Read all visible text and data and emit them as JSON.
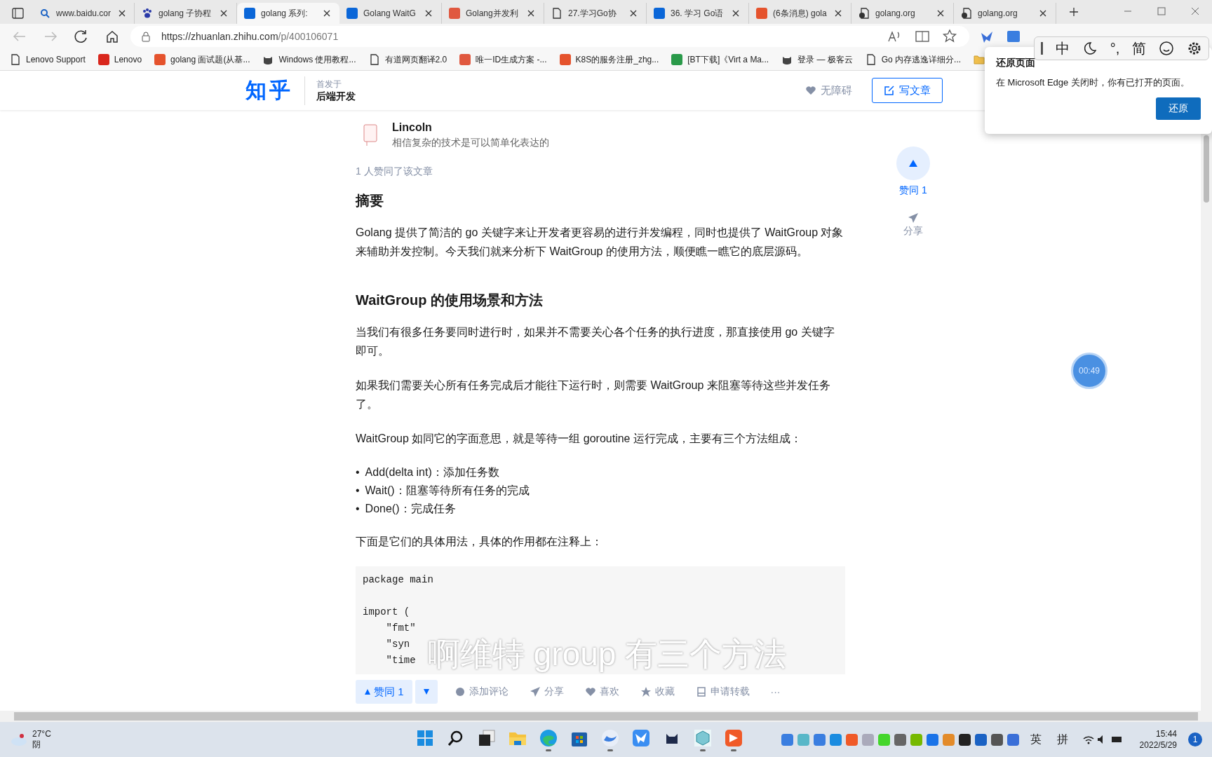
{
  "browser": {
    "tabs": [
      {
        "label": "www.baidu.cor",
        "selected": false
      },
      {
        "label": "golang 子协程",
        "selected": false
      },
      {
        "label": "golang 系列:",
        "selected": true
      },
      {
        "label": "Golang WaitG",
        "selected": false
      },
      {
        "label": "Golang并发利",
        "selected": false
      },
      {
        "label": "27.学习Go协",
        "selected": false
      },
      {
        "label": "36. 学习 Go语",
        "selected": false
      },
      {
        "label": "(6条消息) gola",
        "selected": false
      },
      {
        "label": "golang.org",
        "selected": false
      },
      {
        "label": "golang.org",
        "selected": false
      }
    ],
    "url_host": "https://zhuanlan.zhihu.com",
    "url_path": "/p/400106071",
    "bookmarks": [
      "Lenovo Support",
      "Lenovo",
      "golang 面试题(从基...",
      "Windows 使用教程...",
      "有道网页翻译2.0",
      "唯一ID生成方案 -...",
      "K8S的服务注册_zhg...",
      "[BT下载]《Virt a Ma...",
      "登录 — 极客云",
      "Go 内存逃逸详细分..."
    ]
  },
  "restore_popup": {
    "title": "还原页面",
    "message": "在 Microsoft Edge 关闭时，你有已打开的页面。",
    "button": "还原"
  },
  "ime_toolbar": {
    "mode": "中",
    "punctuation": "°,",
    "script": "简"
  },
  "site_header": {
    "logo": "知乎",
    "published_in": "首发于",
    "column": "后端开发",
    "accessibility": "无障碍",
    "write_button": "写文章"
  },
  "article": {
    "author": "Lincoln",
    "bio": "相信复杂的技术是可以简单化表达的",
    "likes_note": "1 人赞同了该文章",
    "blocks": [
      {
        "kind": "heading",
        "text": "摘要"
      },
      {
        "kind": "paragraph",
        "text": "Golang 提供了简洁的 go 关键字来让开发者更容易的进行并发编程，同时也提供了 WaitGroup 对象来辅助并发控制。今天我们就来分析下 WaitGroup 的使用方法，顺便瞧一瞧它的底层源码。"
      },
      {
        "kind": "heading",
        "text": "WaitGroup 的使用场景和方法"
      },
      {
        "kind": "paragraph",
        "text": "当我们有很多任务要同时进行时，如果并不需要关心各个任务的执行进度，那直接使用 go 关键字即可。"
      },
      {
        "kind": "paragraph",
        "text": "如果我们需要关心所有任务完成后才能往下运行时，则需要 WaitGroup 来阻塞等待这些并发任务了。"
      },
      {
        "kind": "paragraph",
        "text": "WaitGroup 如同它的字面意思，就是等待一组 goroutine 运行完成，主要有三个方法组成："
      },
      {
        "kind": "list",
        "items": [
          {
            "marker": "•",
            "text": "Add(delta int)：添加任务数"
          },
          {
            "marker": "•",
            "text": "Wait()：阻塞等待所有任务的完成"
          },
          {
            "marker": "•",
            "text": "Done()：完成任务"
          }
        ]
      },
      {
        "kind": "paragraph",
        "text": "下面是它们的具体用法，具体的作用都在注释上："
      },
      {
        "kind": "code",
        "groups": [
          [
            "package main"
          ],
          [
            "import (",
            "    \"fmt\"",
            "    \"syn",
            "    \"time"
          ]
        ]
      }
    ]
  },
  "side_actions": {
    "vote": "赞同 1",
    "share": "分享"
  },
  "action_bar": {
    "vote": "赞同 1",
    "comment": "添加评论",
    "share": "分享",
    "like": "喜欢",
    "collect": "收藏",
    "repost": "申请转载",
    "more": "···"
  },
  "caption": "啊维特 group 有三个方法",
  "timer": "00:49",
  "taskbar": {
    "temperature": "27°C",
    "weather": "阴",
    "apps": [
      {
        "kind": "start",
        "running": false
      },
      {
        "kind": "search",
        "running": false
      },
      {
        "kind": "windows",
        "running": false
      },
      {
        "kind": "folder",
        "running": false
      },
      {
        "kind": "browser",
        "running": true
      },
      {
        "kind": "store",
        "running": false
      },
      {
        "kind": "swirl",
        "running": true
      },
      {
        "kind": "bird",
        "running": false
      },
      {
        "kind": "cat",
        "running": false
      },
      {
        "kind": "cube",
        "running": true
      },
      {
        "kind": "player",
        "running": true
      }
    ],
    "language": "英",
    "input": "拼",
    "time": "15:44",
    "date": "2022/5/29",
    "notifications": "1"
  }
}
